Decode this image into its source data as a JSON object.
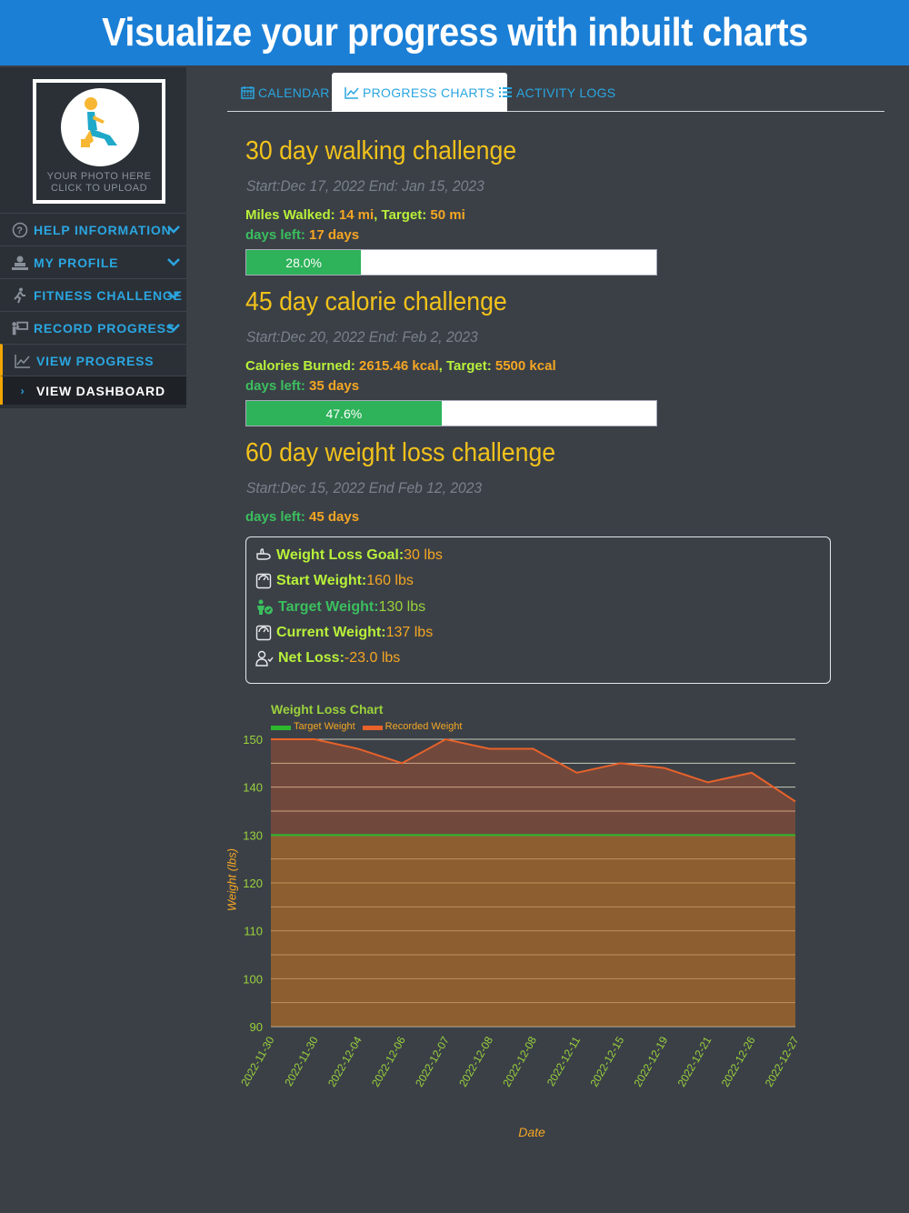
{
  "banner": {
    "title": "Visualize your progress with inbuilt charts"
  },
  "sidebar": {
    "photo_line1": "YOUR PHOTO HERE",
    "photo_line2": "CLICK TO UPLOAD",
    "items": [
      {
        "label": "HELP INFORMATION",
        "icon": "question-circle-icon"
      },
      {
        "label": "MY PROFILE",
        "icon": "profile-icon"
      },
      {
        "label": "FITNESS CHALLENGE",
        "icon": "running-icon"
      },
      {
        "label": "RECORD PROGRESS",
        "icon": "record-icon"
      },
      {
        "label": "VIEW PROGRESS",
        "icon": "line-chart-icon"
      },
      {
        "label": "VIEW DASHBOARD",
        "icon": "chevron-right-icon"
      }
    ]
  },
  "tabs": [
    {
      "label": "CALENDAR",
      "icon": "calendar-icon"
    },
    {
      "label": "PROGRESS CHARTS",
      "icon": "line-chart-icon",
      "active": true
    },
    {
      "label": "ACTIVITY LOGS",
      "icon": "list-icon"
    }
  ],
  "walking": {
    "title": "30 day walking challenge",
    "dates": "Start:Dec 17, 2022 End: Jan 15, 2023",
    "metric_label": "Miles Walked:",
    "metric_value": "14 mi",
    "target_label": "Target:",
    "target_value": "50 mi",
    "days_label": "days left:",
    "days_value": "17 days",
    "progress": 28.0,
    "progress_text": "28.0%"
  },
  "calorie": {
    "title": "45 day calorie challenge",
    "dates": "Start:Dec 20, 2022 End: Feb 2, 2023",
    "metric_label": "Calories Burned:",
    "metric_value": "2615.46 kcal",
    "target_label": "Target:",
    "target_value": "5500 kcal",
    "days_label": "days left:",
    "days_value": "35 days",
    "progress": 47.6,
    "progress_text": "47.6%"
  },
  "weight": {
    "title": "60 day weight loss challenge",
    "dates": "Start:Dec 15, 2022 End Feb 12, 2023",
    "days_label": "days left:",
    "days_value": "45 days",
    "goal_label": "Weight Loss Goal:",
    "goal_value": " 30 lbs",
    "start_label": "Start Weight:",
    "start_value": "160 lbs",
    "target_label": "Target Weight:",
    "target_value": " 130 lbs",
    "current_label": "Current Weight:",
    "current_value": "137 lbs",
    "net_label": "Net Loss:",
    "net_value": " -23.0 lbs"
  },
  "colors": {
    "target_line": "#2eb82e",
    "recorded_line": "#e8622a",
    "label_green": "#9ad23b",
    "axis_orange": "#f5a623"
  },
  "chart_data": {
    "type": "area",
    "title": "Weight Loss Chart",
    "xlabel": "Date",
    "ylabel": "Weight (lbs)",
    "ylim": [
      90,
      150
    ],
    "yticks": [
      90,
      100,
      110,
      120,
      130,
      140,
      150
    ],
    "categories": [
      "2022-11-30",
      "2022-11-30",
      "2022-12-04",
      "2022-12-06",
      "2022-12-07",
      "2022-12-08",
      "2022-12-08",
      "2022-12-11",
      "2022-12-15",
      "2022-12-19",
      "2022-12-21",
      "2022-12-26",
      "2022-12-27"
    ],
    "series": [
      {
        "name": "Target Weight",
        "values": [
          130,
          130,
          130,
          130,
          130,
          130,
          130,
          130,
          130,
          130,
          130,
          130,
          130
        ]
      },
      {
        "name": "Recorded Weight",
        "values": [
          150,
          150,
          148,
          145,
          150,
          148,
          148,
          143,
          145,
          144,
          141,
          143,
          137
        ]
      }
    ],
    "grid": true,
    "legend": "top-left"
  }
}
